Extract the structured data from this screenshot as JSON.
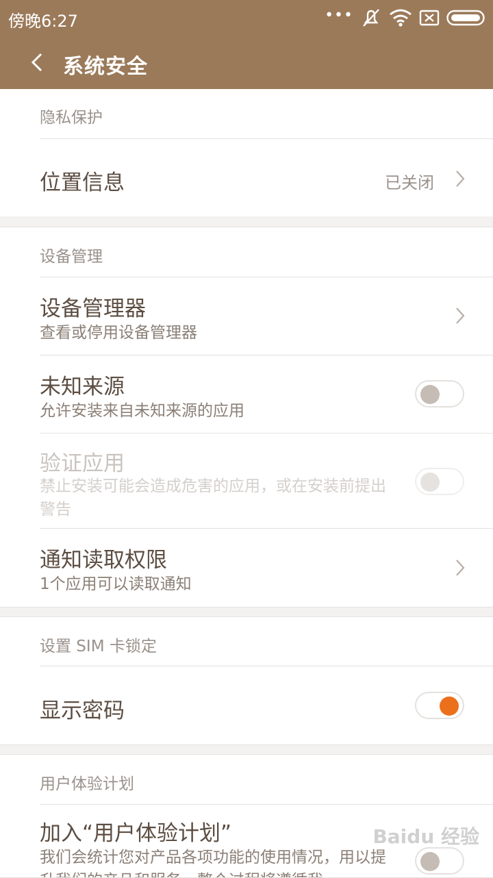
{
  "status_bar": {
    "time": "傍晚6:27"
  },
  "title_bar": {
    "title": "系统安全"
  },
  "sections": {
    "privacy": {
      "header": "隐私保护",
      "location_title": "位置信息",
      "location_value": "已关闭"
    },
    "device": {
      "header": "设备管理",
      "admin_title": "设备管理器",
      "admin_sub": "查看或停用设备管理器",
      "unknown_title": "未知来源",
      "unknown_sub": "允许安装来自未知来源的应用",
      "verify_title": "验证应用",
      "verify_sub": "禁止安装可能会造成危害的应用，或在安装前提出警告",
      "notif_title": "通知读取权限",
      "notif_sub": "1个应用可以读取通知"
    },
    "sim": {
      "header": "设置 SIM 卡锁定",
      "show_pw_title": "显示密码"
    },
    "ux": {
      "header": "用户体验计划",
      "join_title": "加入“用户体验计划”",
      "join_sub": "我们会统计您对产品各项功能的使用情况，用以提升我们的产品和服务，整个过程将遵循我"
    }
  },
  "toggles": {
    "unknown_sources": "off",
    "verify_apps": "off-disabled",
    "show_password": "on",
    "join_ux": "off"
  },
  "watermark": "Baidu 经验",
  "colors": {
    "header_bar": "#9b7a5a",
    "accent": "#ec6f1c"
  }
}
